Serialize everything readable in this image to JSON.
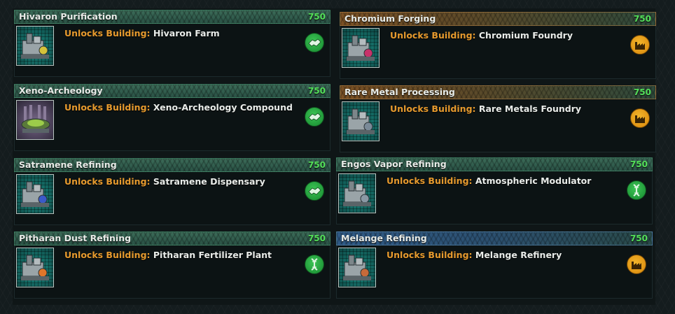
{
  "unlock_label": "Unlocks Building:",
  "cards": [
    {
      "name": "Hivaron Purification",
      "cost": "750",
      "building": "Hivaron Farm",
      "header_color": "green",
      "badge_icon": "handshake-icon",
      "badge_color": "green"
    },
    {
      "name": "Chromium Forging",
      "cost": "750",
      "building": "Chromium Foundry",
      "header_color": "orange",
      "badge_icon": "factory-icon",
      "badge_color": "orange"
    },
    {
      "name": "Xeno-Archeology",
      "cost": "750",
      "building": "Xeno-Archeology Compound",
      "header_color": "green",
      "badge_icon": "handshake-icon",
      "badge_color": "green"
    },
    {
      "name": "Rare Metal Processing",
      "cost": "750",
      "building": "Rare Metals Foundry",
      "header_color": "orange",
      "badge_icon": "factory-icon",
      "badge_color": "orange"
    },
    {
      "name": "Satramene Refining",
      "cost": "750",
      "building": "Satramene Dispensary",
      "header_color": "green",
      "badge_icon": "handshake-icon",
      "badge_color": "green"
    },
    {
      "name": "Engos Vapor Refining",
      "cost": "750",
      "building": "Atmospheric Modulator",
      "header_color": "green",
      "badge_icon": "dna-icon",
      "badge_color": "green"
    },
    {
      "name": "Pitharan Dust Refining",
      "cost": "750",
      "building": "Pitharan Fertilizer Plant",
      "header_color": "green",
      "badge_icon": "dna-icon",
      "badge_color": "green"
    },
    {
      "name": "Melange Refining",
      "cost": "750",
      "building": "Melange Refinery",
      "header_color": "blue",
      "badge_icon": "factory-icon",
      "badge_color": "orange"
    }
  ],
  "colors": {
    "cost": "#54e05a",
    "unlock_label": "#e69a2e",
    "badge_green": "#219a3a",
    "badge_orange": "#e09414"
  }
}
